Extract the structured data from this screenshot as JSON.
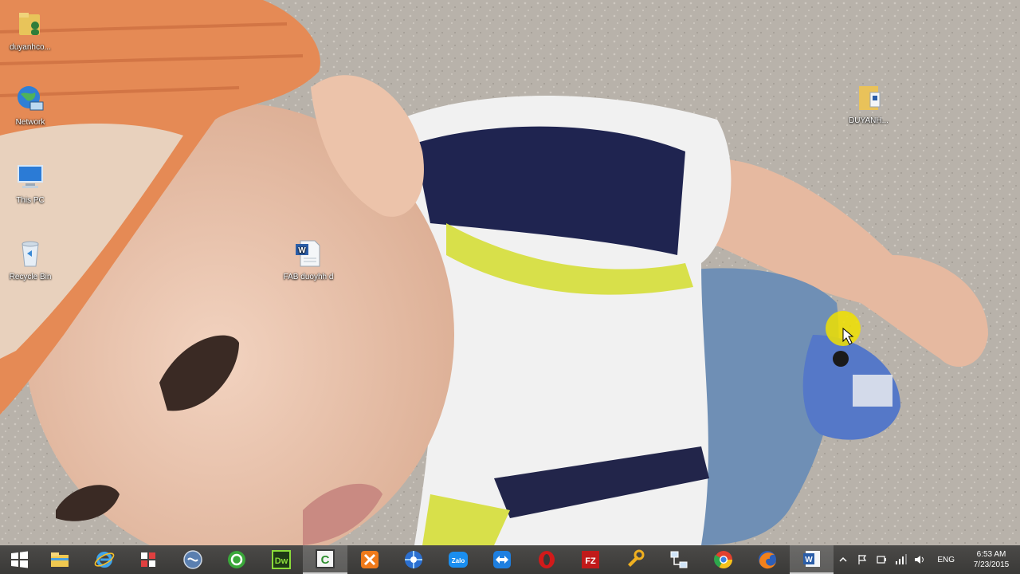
{
  "desktop": {
    "icons": [
      {
        "name": "user-folder",
        "label": "duyanhco...",
        "icon": "user-folder-icon"
      },
      {
        "name": "network",
        "label": "Network",
        "icon": "network-icon"
      },
      {
        "name": "this-pc",
        "label": "This PC",
        "icon": "this-pc-icon"
      },
      {
        "name": "recycle-bin",
        "label": "Recycle Bin",
        "icon": "recycle-bin-icon"
      },
      {
        "name": "word-document",
        "label": "FAB duoyhh d",
        "icon": "word-document-icon"
      },
      {
        "name": "folder-right",
        "label": "DUYANH...",
        "icon": "folder-icon"
      }
    ],
    "cursor_highlight_color": "#f0e000"
  },
  "taskbar": {
    "background": "#3a3937",
    "pinned": [
      {
        "name": "start",
        "icon": "windows-logo-icon"
      },
      {
        "name": "file-explorer",
        "icon": "file-explorer-icon"
      },
      {
        "name": "internet-explorer",
        "icon": "internet-explorer-icon"
      },
      {
        "name": "apps-grid",
        "icon": "apps-grid-icon"
      },
      {
        "name": "app-blue-circle",
        "icon": "globe-app-icon"
      },
      {
        "name": "camtasia-recorder",
        "icon": "recorder-icon"
      },
      {
        "name": "dreamweaver",
        "icon": "dreamweaver-icon",
        "text": "Dw"
      },
      {
        "name": "camtasia",
        "icon": "camtasia-icon",
        "text": "C",
        "active": true
      },
      {
        "name": "xampp",
        "icon": "xampp-icon"
      },
      {
        "name": "media-app",
        "icon": "media-icon"
      },
      {
        "name": "zalo",
        "icon": "zalo-icon",
        "text": "Zalo"
      },
      {
        "name": "teamviewer",
        "icon": "teamviewer-icon"
      },
      {
        "name": "opera",
        "icon": "opera-icon"
      },
      {
        "name": "filezilla",
        "icon": "filezilla-icon",
        "text": "FZ"
      },
      {
        "name": "tools-app",
        "icon": "tools-icon"
      },
      {
        "name": "network-app",
        "icon": "network-app-icon"
      },
      {
        "name": "chrome",
        "icon": "chrome-icon"
      },
      {
        "name": "firefox",
        "icon": "firefox-icon"
      },
      {
        "name": "word",
        "icon": "word-icon",
        "text": "W",
        "active": true
      }
    ],
    "tray": {
      "lang": "ENG",
      "time": "6:53 AM",
      "date": "7/23/2015"
    }
  }
}
